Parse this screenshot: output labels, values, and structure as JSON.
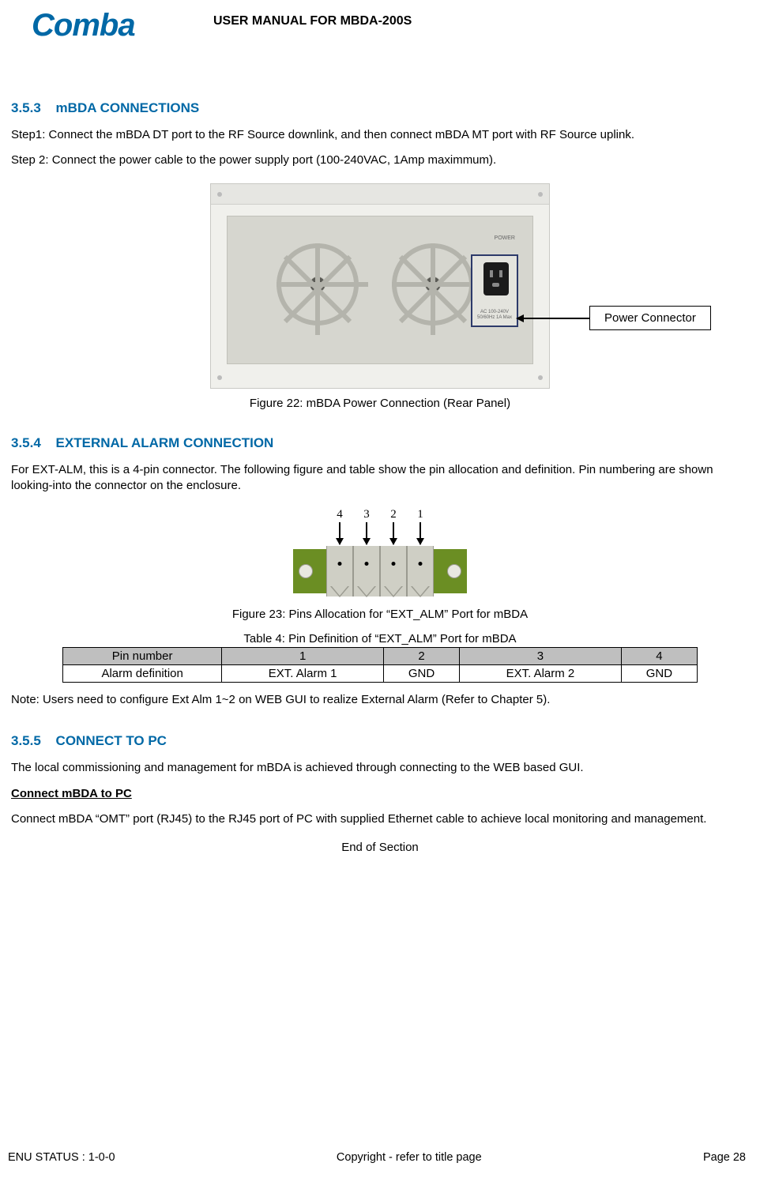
{
  "header": {
    "logo": "Comba",
    "doc_title": "USER MANUAL FOR MBDA-200S"
  },
  "sections": {
    "s353": {
      "num": "3.5.3",
      "title": "mBDA CONNECTIONS",
      "step1": "Step1: Connect the mBDA DT port to the RF Source downlink, and then connect mBDA MT port with RF Source uplink.",
      "step2": "Step 2: Connect the power cable to the power supply port (100-240VAC, 1Amp maximmum).",
      "callout": "Power Connector",
      "fig_caption": "Figure 22: mBDA Power Connection (Rear Panel)",
      "pwr_label": "POWER",
      "pwr_sub": "AC 100-240V 50/60Hz 1A Max"
    },
    "s354": {
      "num": "3.5.4",
      "title": "EXTERNAL ALARM CONNECTION",
      "para": "For EXT-ALM, this is a 4-pin connector. The following figure and table show the pin allocation and definition. Pin numbering are shown looking-into the connector on the enclosure.",
      "fig_caption": "Figure 23:  Pins Allocation for “EXT_ALM” Port for mBDA",
      "tbl_caption": "Table 4: Pin Definition of “EXT_ALM” Port for mBDA",
      "pin_labels": [
        "4",
        "3",
        "2",
        "1"
      ],
      "table": {
        "row1": [
          "Pin number",
          "1",
          "2",
          "3",
          "4"
        ],
        "row2": [
          "Alarm definition",
          "EXT. Alarm 1",
          "GND",
          "EXT. Alarm 2",
          "GND"
        ]
      },
      "note": "Note: Users need to configure Ext Alm 1~2 on WEB GUI to realize External Alarm (Refer to Chapter 5)."
    },
    "s355": {
      "num": "3.5.5",
      "title": "CONNECT TO PC",
      "para1": "The local commissioning and management for mBDA is achieved through connecting to the WEB based GUI.",
      "subhead": "Connect mBDA to PC",
      "para2": "Connect mBDA “OMT” port (RJ45) to the RJ45 port of PC with supplied Ethernet cable to achieve local monitoring and management.",
      "end": "End of Section"
    }
  },
  "footer": {
    "left": "ENU STATUS : 1-0-0",
    "center": "Copyright - refer to title page",
    "right": "Page 28"
  }
}
